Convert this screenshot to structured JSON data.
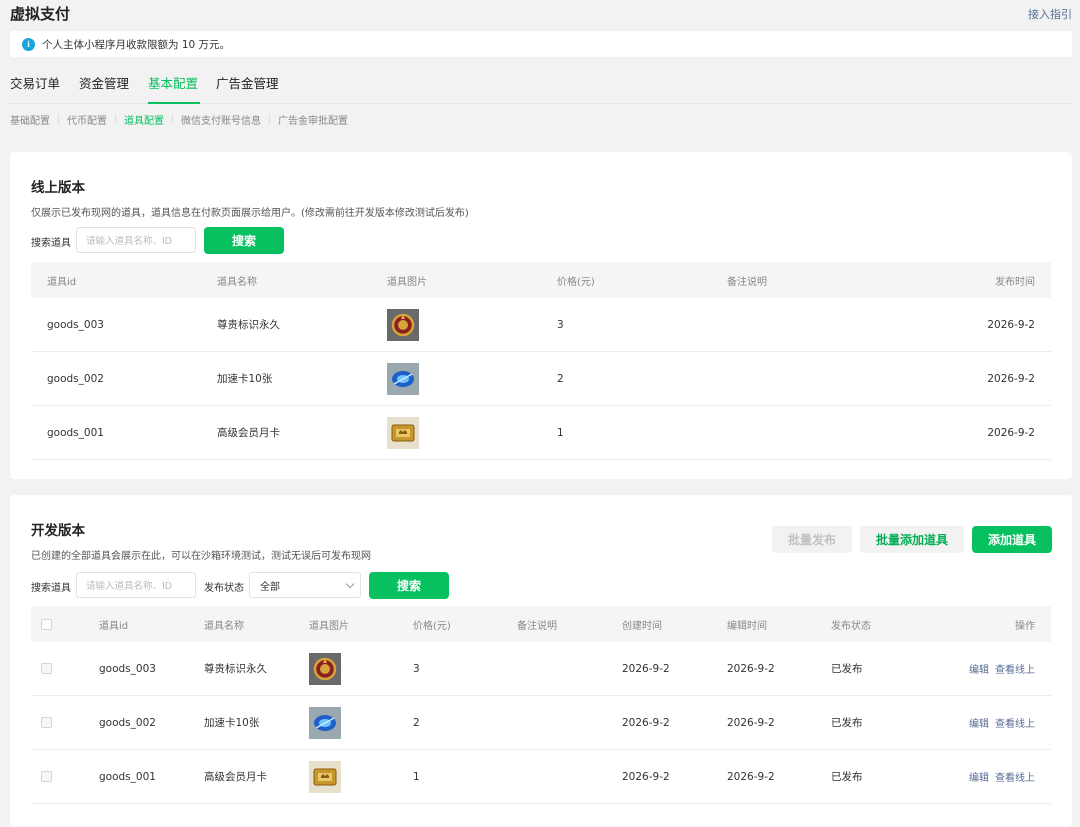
{
  "header": {
    "title": "虚拟支付",
    "guide_link": "接入指引"
  },
  "notice": {
    "text": "个人主体小程序月收款限额为 10 万元。",
    "icon": "info-icon"
  },
  "main_tabs": [
    "交易订单",
    "资金管理",
    "基本配置",
    "广告金管理"
  ],
  "sub_tabs": [
    "基础配置",
    "代币配置",
    "道具配置",
    "微信支付账号信息",
    "广告金审批配置"
  ],
  "colors": {
    "accent": "#07c160",
    "link": "#576b95"
  },
  "online": {
    "title": "线上版本",
    "desc": "仅展示已发布现网的道具，道具信息在付款页面展示给用户。(修改需前往开发版本修改测试后发布)",
    "search_label": "搜索道具",
    "search_placeholder": "请输入道具名称、ID",
    "search_button": "搜索",
    "columns": [
      "道具id",
      "道具名称",
      "道具图片",
      "价格(元)",
      "备注说明",
      "发布时间"
    ],
    "rows": [
      {
        "id": "goods_003",
        "name": "尊贵标识永久",
        "image": "badge-image",
        "price": "3",
        "remark": "",
        "published": "2026-9-2"
      },
      {
        "id": "goods_002",
        "name": "加速卡10张",
        "image": "speed-card-image",
        "price": "2",
        "remark": "",
        "published": "2026-9-2"
      },
      {
        "id": "goods_001",
        "name": "高级会员月卡",
        "image": "vip-card-image",
        "price": "1",
        "remark": "",
        "published": "2026-9-2"
      }
    ]
  },
  "dev": {
    "title": "开发版本",
    "desc": "已创建的全部道具会展示在此，可以在沙箱环境测试，测试无误后可发布现网",
    "batch_publish": "批量发布",
    "batch_add": "批量添加道具",
    "add": "添加道具",
    "search_label": "搜索道具",
    "search_placeholder": "请输入道具名称、ID",
    "status_label": "发布状态",
    "status_value": "全部",
    "search_button": "搜索",
    "columns": [
      "道具id",
      "道具名称",
      "道具图片",
      "价格(元)",
      "备注说明",
      "创建时间",
      "编辑时间",
      "发布状态",
      "操作"
    ],
    "rows": [
      {
        "id": "goods_003",
        "name": "尊贵标识永久",
        "image": "badge-image",
        "price": "3",
        "remark": "",
        "created": "2026-9-2",
        "edited": "2026-9-2",
        "status": "已发布",
        "ops": [
          "编辑",
          "查看线上"
        ]
      },
      {
        "id": "goods_002",
        "name": "加速卡10张",
        "image": "speed-card-image",
        "price": "2",
        "remark": "",
        "created": "2026-9-2",
        "edited": "2026-9-2",
        "status": "已发布",
        "ops": [
          "编辑",
          "查看线上"
        ]
      },
      {
        "id": "goods_001",
        "name": "高级会员月卡",
        "image": "vip-card-image",
        "price": "1",
        "remark": "",
        "created": "2026-9-2",
        "edited": "2026-9-2",
        "status": "已发布",
        "ops": [
          "编辑",
          "查看线上"
        ]
      }
    ]
  }
}
